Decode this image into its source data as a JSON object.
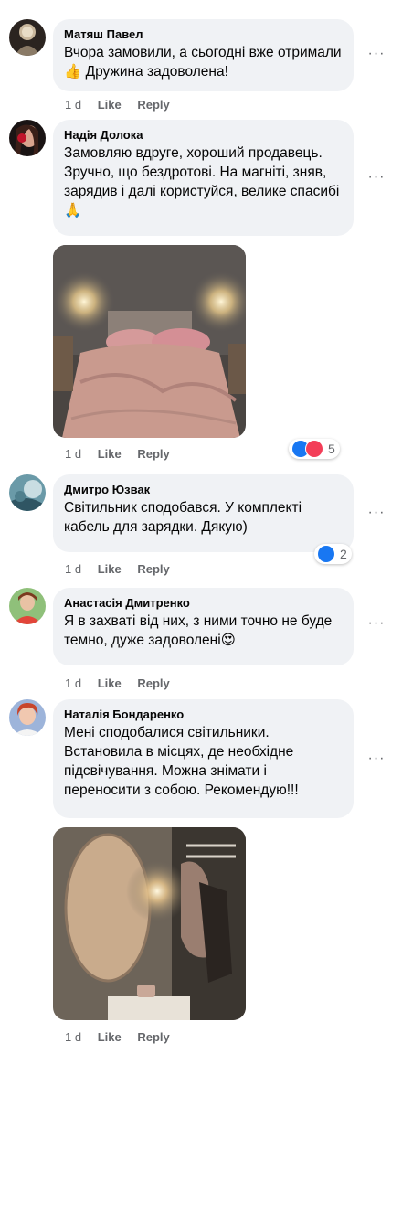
{
  "comments": [
    {
      "author": "Матяш Павел",
      "text": "Вчора замовили, а сьогодні вже отримали👍 Дружина задоволена!",
      "time": "1 d",
      "like": "Like",
      "reply": "Reply"
    },
    {
      "author": "Надія Долока",
      "text": "Замовляю вдруге, хороший продавець. Зручно, що бездротові. На магніті, зняв, зарядив і далі користуйся, велике спасибі🙏",
      "time": "1 d",
      "like": "Like",
      "reply": "Reply",
      "reaction_count": "5"
    },
    {
      "author": "Дмитро Юзвак",
      "text": "Світильник сподобався. У комплекті кабель для зарядки. Дякую)",
      "time": "1 d",
      "like": "Like",
      "reply": "Reply",
      "reaction_count": "2"
    },
    {
      "author": "Анастасія Дмитренко",
      "text": "Я в захваті від них, з ними точно не буде темно, дуже задоволені😍",
      "time": "1 d",
      "like": "Like",
      "reply": "Reply"
    },
    {
      "author": "Наталія Бондаренко",
      "text": "Мені сподобалися світильники. Встановила в місцях, де необхідне підсвічування. Можна знімати і переносити з собою. Рекомендую!!!",
      "time": "1 d",
      "like": "Like",
      "reply": "Reply"
    }
  ],
  "more_glyph": "···",
  "colors": {
    "bubble": "#f0f2f5",
    "meta": "#65676b",
    "like": "#1877f2",
    "love": "#f33e58"
  }
}
